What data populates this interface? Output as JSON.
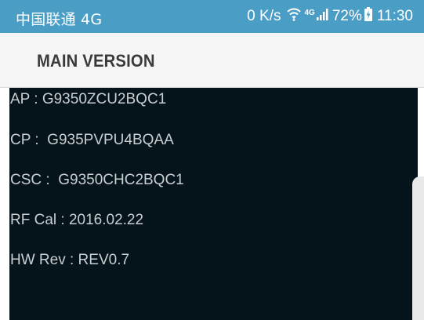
{
  "status_bar": {
    "carrier": "中国联通 4G",
    "net_speed": "0 K/s",
    "network_type": "4G",
    "battery_percent": "72%",
    "time": "11:30",
    "icons": [
      "wifi-icon",
      "signal-icon",
      "battery-charging-icon"
    ]
  },
  "header": {
    "title": "MAIN VERSION"
  },
  "info": [
    {
      "label": "AP : G9350ZCU2BQC1"
    },
    {
      "label": "CP :  G935PVPU4BQAA"
    },
    {
      "label": "CSC :  G9350CHC2BQC1"
    },
    {
      "label": "RF Cal : 2016.02.22"
    },
    {
      "label": "HW Rev : REV0.7"
    }
  ],
  "colors": {
    "status_bar_bg": "#4a9ec5",
    "header_bg": "#f5f5f5",
    "content_bg": "#05141b",
    "text": "#c9ced1"
  }
}
